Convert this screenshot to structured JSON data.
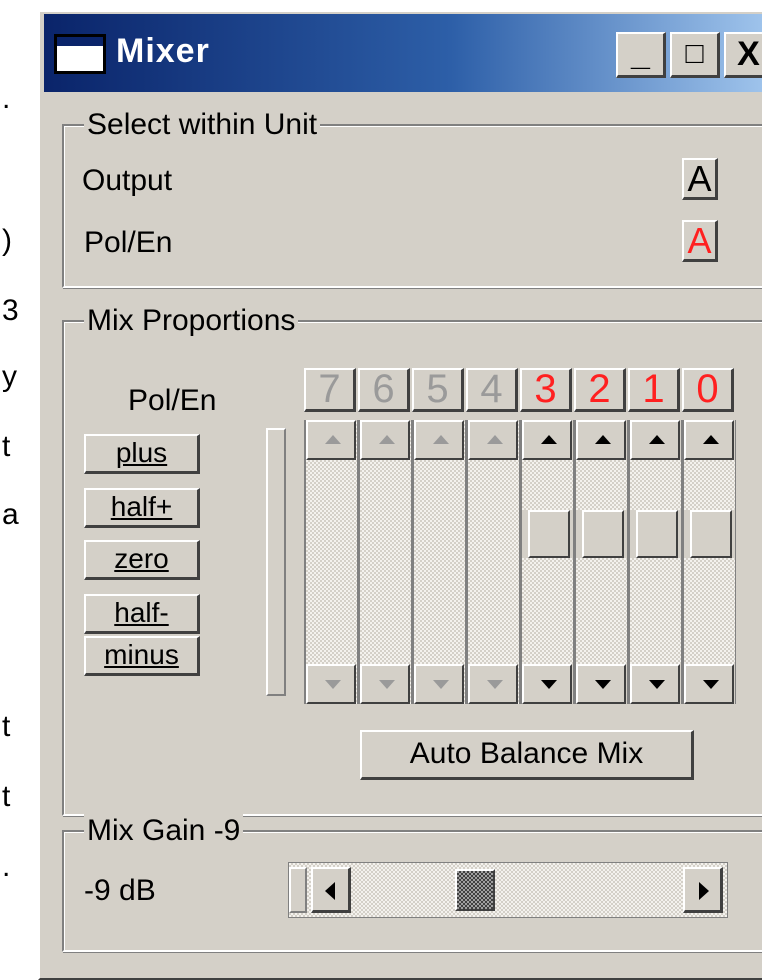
{
  "window": {
    "title": "Mixer",
    "minimize": "_",
    "maximize": "□",
    "close": "X"
  },
  "left_edge_glyphs": [
    ".",
    ")",
    "3",
    "y",
    "t",
    "a",
    "t",
    "t",
    "."
  ],
  "select_group": {
    "legend": "Select within Unit",
    "output_label": "Output",
    "output_button": "A",
    "polen_label": "Pol/En",
    "polen_button": "A"
  },
  "mix_group": {
    "legend": "Mix Proportions",
    "polen_label": "Pol/En",
    "buttons": [
      "plus",
      "half+",
      "zero",
      "half-",
      "minus"
    ],
    "channels": [
      "7",
      "6",
      "5",
      "4",
      "3",
      "2",
      "1",
      "0"
    ],
    "channel_colors": {
      "disabled": "#9a9a9a",
      "active": "#ff2020"
    },
    "auto_balance": "Auto Balance Mix"
  },
  "gain_group": {
    "legend": "Mix Gain -9",
    "value_label": "-9 dB"
  }
}
